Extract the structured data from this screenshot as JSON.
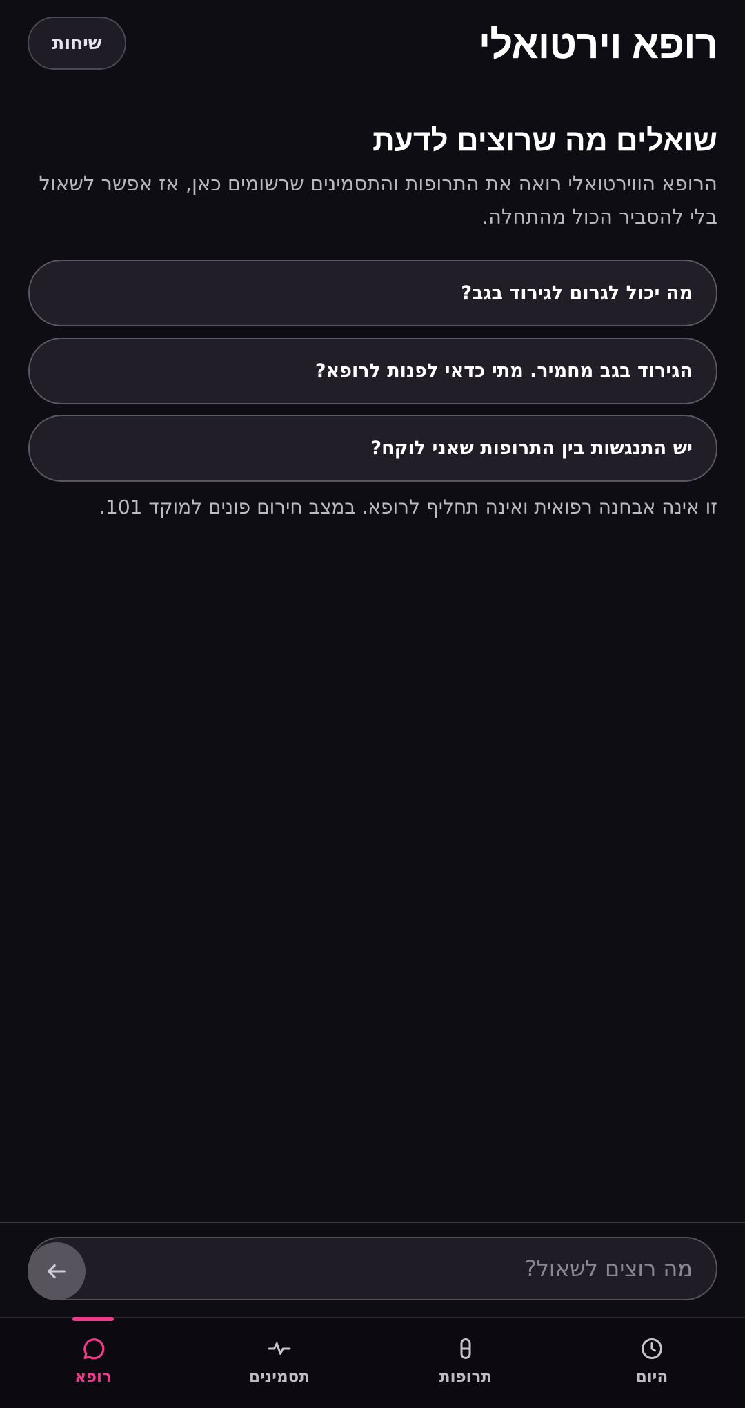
{
  "header": {
    "title": "רופא וירטואלי",
    "chats_button": "שיחות"
  },
  "intro": {
    "title": "שואלים מה שרוצים לדעת",
    "text": "הרופא הווירטואלי רואה את התרופות והתסמינים שרשומים כאן, אז אפשר לשאול בלי להסביר הכול מהתחלה."
  },
  "suggestions": [
    "מה יכול לגרום לגירוד בגב?",
    "הגירוד בגב מחמיר. מתי כדאי לפנות לרופא?",
    "יש התנגשות בין התרופות שאני לוקח?"
  ],
  "disclaimer": "זו אינה אבחנה רפואית ואינה תחליף לרופא. במצב חירום פונים למוקד 101.",
  "composer": {
    "placeholder": "מה רוצים לשאול?",
    "send_icon": "arrow-left-icon"
  },
  "nav": {
    "items": [
      {
        "label": "היום",
        "icon": "clock-icon"
      },
      {
        "label": "תרופות",
        "icon": "pill-icon"
      },
      {
        "label": "תסמינים",
        "icon": "activity-icon"
      },
      {
        "label": "רופא",
        "icon": "chat-bubble-icon"
      }
    ],
    "active": "רופא"
  },
  "colors": {
    "background": "#0f0d14",
    "accent": "#ee3b8a",
    "card": "#211e28"
  }
}
